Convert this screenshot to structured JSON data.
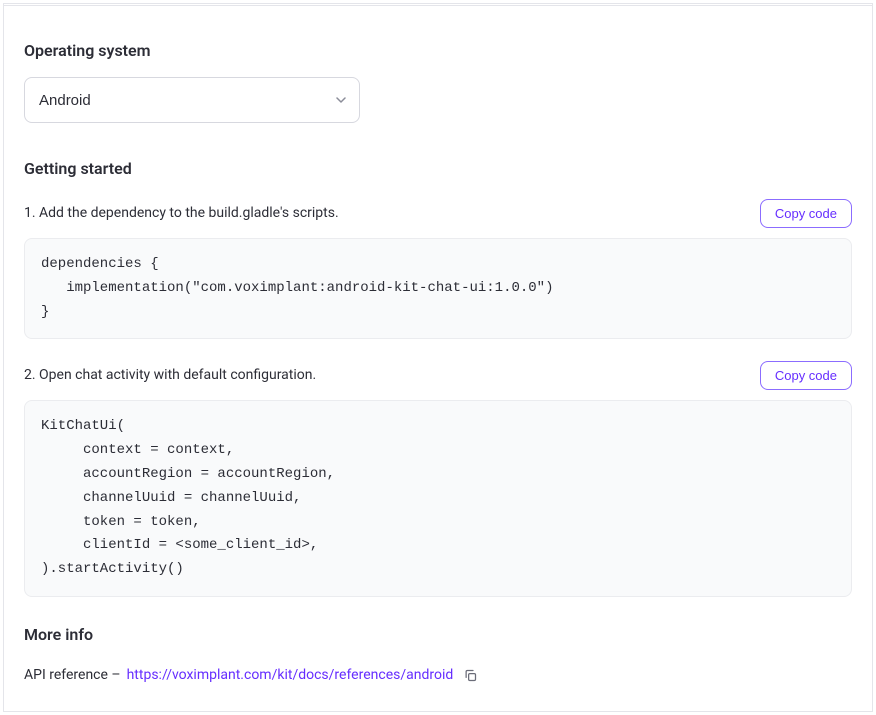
{
  "os_section": {
    "heading": "Operating system",
    "selected": "Android"
  },
  "getting_started": {
    "heading": "Getting started",
    "steps": [
      {
        "text": "1. Add the dependency to the build.gladle's scripts.",
        "copy_label": "Copy code",
        "code": "dependencies {\n   implementation(\"com.voximplant:android-kit-chat-ui:1.0.0\")\n}"
      },
      {
        "text": "2. Open chat activity with default configuration.",
        "copy_label": "Copy code",
        "code": "KitChatUi(\n     context = context,\n     accountRegion = accountRegion,\n     channelUuid = channelUuid,\n     token = token,\n     clientId = <some_client_id>,\n).startActivity()"
      }
    ]
  },
  "more_info": {
    "heading": "More info",
    "prefix": "API reference – ",
    "link_text": "https://voximplant.com/kit/docs/references/android"
  }
}
